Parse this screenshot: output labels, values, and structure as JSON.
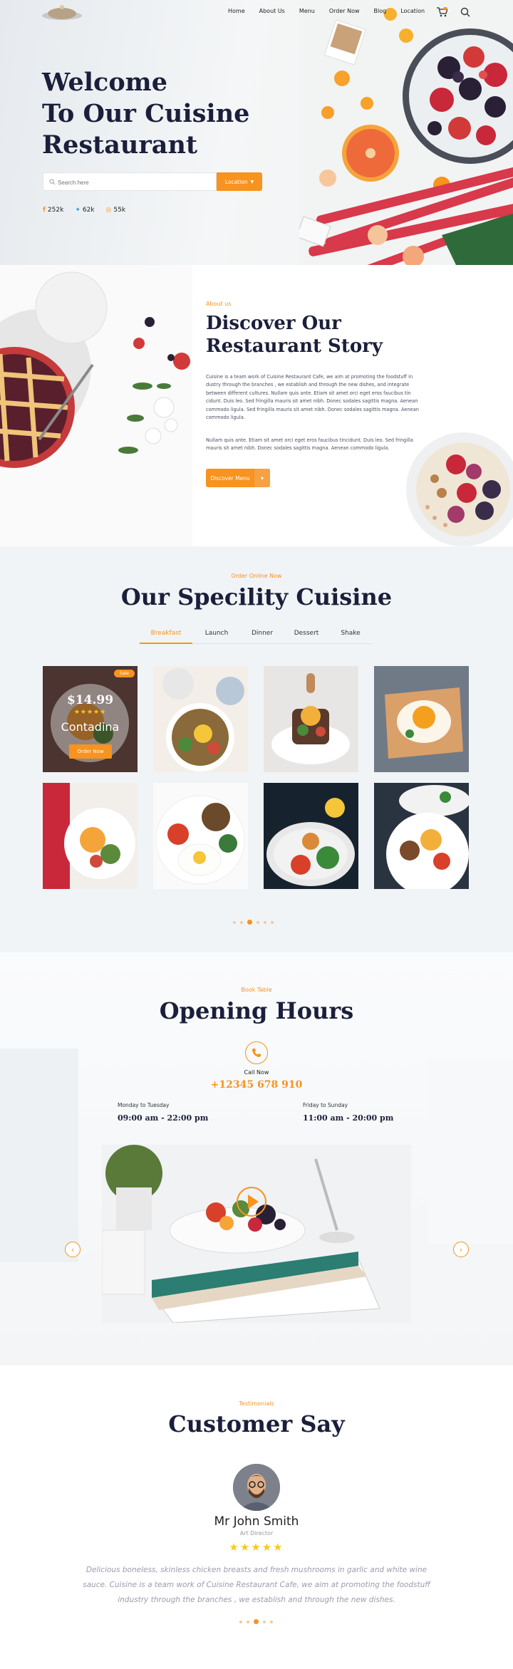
{
  "nav": {
    "items": [
      "Home",
      "About Us",
      "Menu",
      "Order Now",
      "Blog",
      "Location"
    ]
  },
  "hero": {
    "title_line1": "Welcome",
    "title_line2": "To Our Cuisine",
    "title_line3": "Restaurant",
    "search_placeholder": "Search here",
    "location_label": "Location",
    "social": [
      {
        "icon": "facebook-icon",
        "count": "252k"
      },
      {
        "icon": "twitter-icon",
        "count": "62k"
      },
      {
        "icon": "instagram-icon",
        "count": "55k"
      }
    ]
  },
  "story": {
    "kicker": "About us",
    "title_line1": "Discover Our",
    "title_line2": "Restaurant Story",
    "para1": "Cuisine is a team work of Cuisine Restaurant Cafe, we aim at promoting the foodstuff in dustry through the branches , we establish and through the new dishes, and integrate between different cultures. Nullam quis ante. Etiam sit amet orci eget eros faucibus tin cidunt. Duis leo. Sed fringilla mauris sit amet nibh. Donec sodales sagittis magna. Aenean commodo ligula. Sed fringilla mauris sit amet nibh. Donec sodales sagittis magna. Aenean commodo ligula.",
    "para2": "Nullam quis ante. Etiam sit amet orci eget eros faucibus tincidunt. Duis leo. Sed fringilla mauris sit amet nibh. Donec sodales sagittis magna. Aenean commodo ligula.",
    "button": "Discover Menu"
  },
  "speciality": {
    "kicker": "Order Online Now",
    "title": "Our Specility Cuisine",
    "tabs": [
      "Breakfast",
      "Launch",
      "Dinner",
      "Dessert",
      "Shake"
    ],
    "active_tab": "Breakfast",
    "featured": {
      "badge": "Sale",
      "price": "$14.99",
      "stars": "★★★★★",
      "name": "Contadina",
      "button": "Order Now"
    }
  },
  "opening": {
    "kicker": "Book Table",
    "title": "Opening Hours",
    "call_label": "Call Now",
    "phone": "+12345 678 910",
    "left_days": "Monday to Tuesday",
    "left_hours": "09:00 am - 22:00 pm",
    "right_days": "Friday to Sunday",
    "right_hours": "11:00 am - 20:00 pm",
    "prev": "‹",
    "next": "›"
  },
  "testimonial": {
    "kicker": "Testimonials",
    "title": "Customer Say",
    "name": "Mr John Smith",
    "role": "Art Director",
    "stars": "★★★★★",
    "quote": "Delicious boneless, skinless chicken breasts and fresh mushrooms in garlic and white wine sauce. Cuisine is a team work of Cuisine Restaurant Cafe, we aim at promoting the foodstuff industry through the branches , we establish and through the new dishes."
  },
  "colors": {
    "accent": "#f7931e",
    "dark": "#1b1f3b"
  }
}
